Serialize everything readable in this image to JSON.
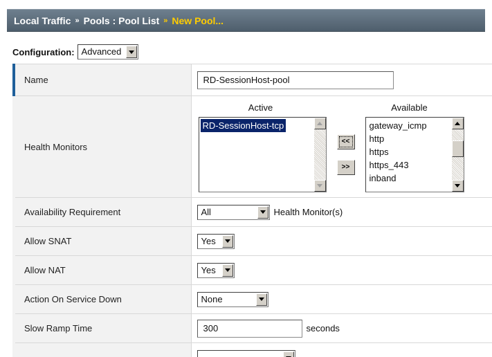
{
  "breadcrumb": {
    "items": [
      "Local Traffic",
      "Pools : Pool List"
    ],
    "current": "New Pool...",
    "separator": "»",
    "highlight_color": "#ffcc00"
  },
  "configuration": {
    "label": "Configuration:",
    "selected": "Advanced"
  },
  "form": {
    "name": {
      "label": "Name",
      "value": "RD-SessionHost-pool"
    },
    "health_monitors": {
      "label": "Health Monitors",
      "active_header": "Active",
      "available_header": "Available",
      "active_items": [
        "RD-SessionHost-tcp"
      ],
      "available_items": [
        "gateway_icmp",
        "http",
        "https",
        "https_443",
        "inband"
      ],
      "move_left_label": "<<",
      "move_right_label": ">>"
    },
    "availability_requirement": {
      "label": "Availability Requirement",
      "selected": "All",
      "suffix": "Health Monitor(s)"
    },
    "allow_snat": {
      "label": "Allow SNAT",
      "selected": "Yes"
    },
    "allow_nat": {
      "label": "Allow NAT",
      "selected": "Yes"
    },
    "action_on_service_down": {
      "label": "Action On Service Down",
      "selected": "None"
    },
    "slow_ramp_time": {
      "label": "Slow Ramp Time",
      "value": "300",
      "suffix": "seconds"
    }
  },
  "colors": {
    "header_bar": "#5c6d7b",
    "label_bg": "#f2f2f2",
    "first_row_accent": "#1f5f9a",
    "selected_option": "#0a246a"
  }
}
